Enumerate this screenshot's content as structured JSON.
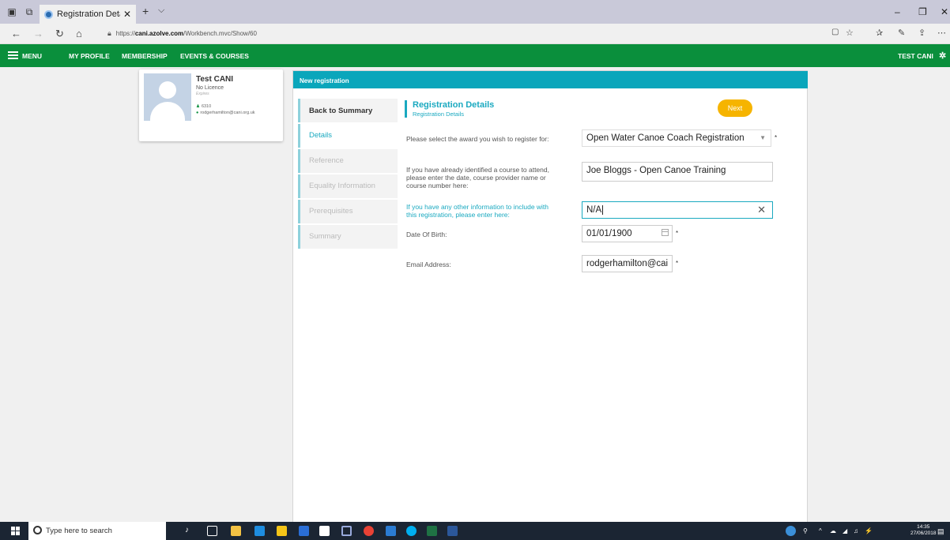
{
  "browser": {
    "tab_title": "Registration Details - Gi",
    "tab_close": "✕",
    "new_tab": "+",
    "tab_menu": "⌵",
    "url_prefix": "https://",
    "url_domain": "cani.azolve.com",
    "url_path": "/Workbench.mvc/Show/60"
  },
  "appnav": {
    "menu": "MENU",
    "my_profile": "MY PROFILE",
    "membership": "MEMBERSHIP",
    "events_courses": "EVENTS & COURSES",
    "user": "TEST CANI"
  },
  "profile": {
    "name": "Test CANI",
    "licence": "No Licence",
    "expires": "Expires",
    "id": "6310",
    "email": "rodgerhamilton@cani.org.uk"
  },
  "panel": {
    "title": "New registration"
  },
  "steps": [
    {
      "label": "Back to Summary"
    },
    {
      "label": "Details"
    },
    {
      "label": "Reference"
    },
    {
      "label": "Equality Information"
    },
    {
      "label": "Prerequisites"
    },
    {
      "label": "Summary"
    }
  ],
  "form": {
    "section_title": "Registration Details",
    "section_subtitle": "Registration Details",
    "next_label": "Next",
    "award_label": "Please select the award you wish to register for:",
    "award_value": "Open Water Canoe Coach Registration",
    "course_label_1": "If you have already identified a course to attend,",
    "course_label_2": "please enter the date, course provider name or",
    "course_label_3": "course number here:",
    "course_value": "Joe Bloggs - Open Canoe Training",
    "other_label_1": "If you have any other information to include with",
    "other_label_2": "this registration, please enter here:",
    "other_value": "N/A",
    "dob_label": "Date Of Birth:",
    "dob_value": "01/01/1900",
    "email_label": "Email Address:",
    "email_value": "rodgerhamilton@cai",
    "required_marker": "*"
  },
  "taskbar": {
    "search_placeholder": "Type here to search",
    "time": "14:35",
    "date": "27/06/2018"
  },
  "colors": {
    "app_green": "#0a8f3c",
    "panel_teal": "#0aa6bb",
    "accent": "#1aa9c0",
    "next_button": "#f6b400"
  }
}
